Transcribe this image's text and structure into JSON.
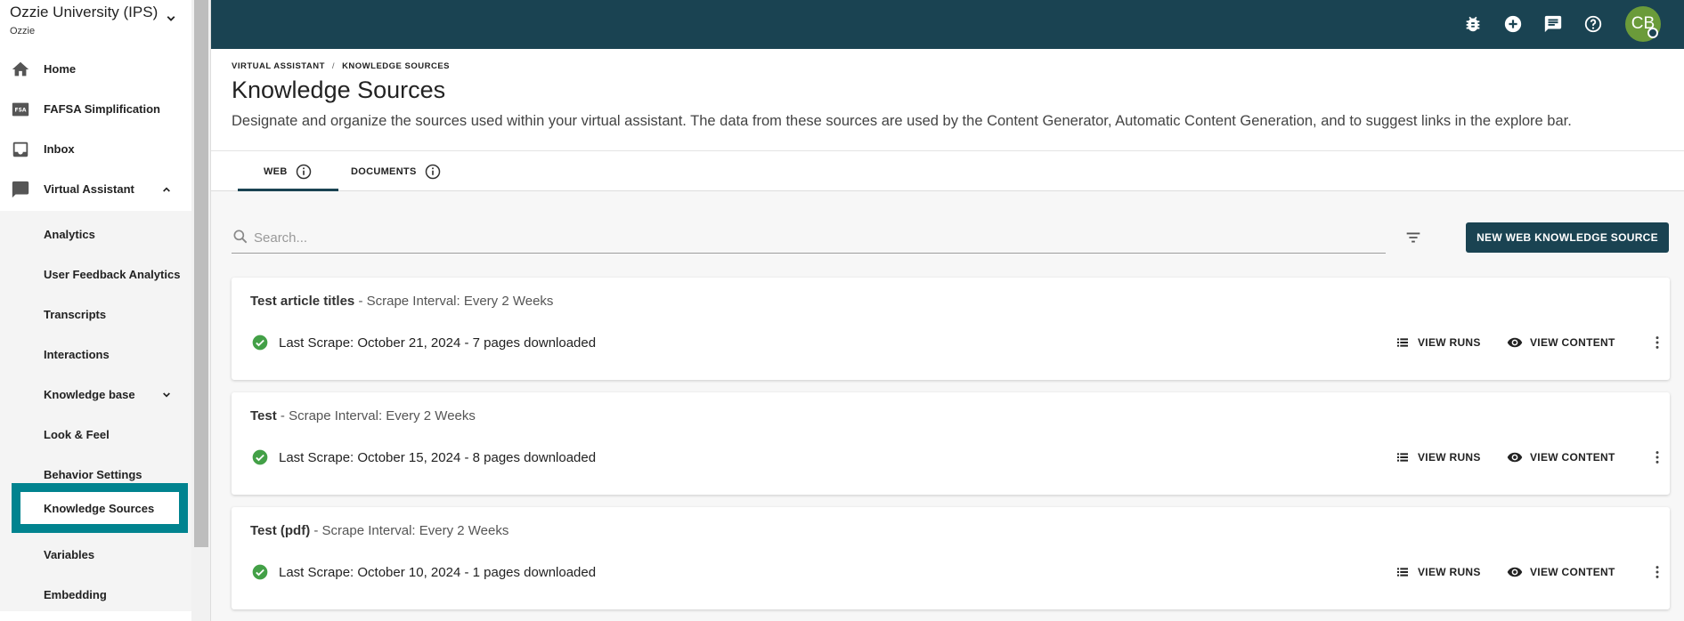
{
  "sidebar": {
    "org_name": "Ozzie University (IPS)",
    "org_sub": "Ozzie",
    "items": [
      {
        "label": "Home",
        "icon": "home-icon"
      },
      {
        "label": "FAFSA Simplification",
        "icon": "fsa-icon",
        "icon_text": "FSA"
      },
      {
        "label": "Inbox",
        "icon": "inbox-icon"
      },
      {
        "label": "Virtual Assistant",
        "icon": "chat-icon",
        "expanded": true
      }
    ],
    "subitems": [
      {
        "label": "Analytics"
      },
      {
        "label": "User Feedback Analytics"
      },
      {
        "label": "Transcripts"
      },
      {
        "label": "Interactions"
      },
      {
        "label": "Knowledge base",
        "collapsible": true
      },
      {
        "label": "Look & Feel"
      },
      {
        "label": "Behavior Settings"
      },
      {
        "label": "Knowledge Sources",
        "active": true
      },
      {
        "label": "Variables"
      },
      {
        "label": "Embedding"
      }
    ]
  },
  "topbar": {
    "icons": [
      "bug-icon",
      "add-circle-icon",
      "chat-icon",
      "help-icon"
    ],
    "avatar_initials": "CB",
    "color": "#1a4352"
  },
  "header": {
    "breadcrumb": [
      "VIRTUAL ASSISTANT",
      "KNOWLEDGE SOURCES"
    ],
    "breadcrumb_sep": "/",
    "title": "Knowledge Sources",
    "description": "Designate and organize the sources used within your virtual assistant. The data from these sources are used by the Content Generator, Automatic Content Generation, and to suggest links in the explore bar."
  },
  "tabs": [
    {
      "label": "WEB",
      "active": true
    },
    {
      "label": "DOCUMENTS",
      "active": false
    }
  ],
  "toolbar": {
    "search_placeholder": "Search...",
    "new_button": "NEW WEB KNOWLEDGE SOURCE"
  },
  "sources": [
    {
      "name": "Test article titles",
      "interval": " - Scrape Interval: Every 2 Weeks",
      "status": "Last Scrape: October 21, 2024 - 7 pages downloaded"
    },
    {
      "name": "Test",
      "interval": " - Scrape Interval: Every 2 Weeks",
      "status": "Last Scrape: October 15, 2024 - 8 pages downloaded"
    },
    {
      "name": "Test (pdf)",
      "interval": " - Scrape Interval: Every 2 Weeks",
      "status": "Last Scrape: October 10, 2024 - 1 pages downloaded"
    }
  ],
  "actions": {
    "view_runs": "VIEW RUNS",
    "view_content": "VIEW CONTENT"
  },
  "colors": {
    "accent": "#1a4352",
    "active_nav_border": "#00838f",
    "success": "#43a047",
    "avatar": "#6b9b3a"
  }
}
